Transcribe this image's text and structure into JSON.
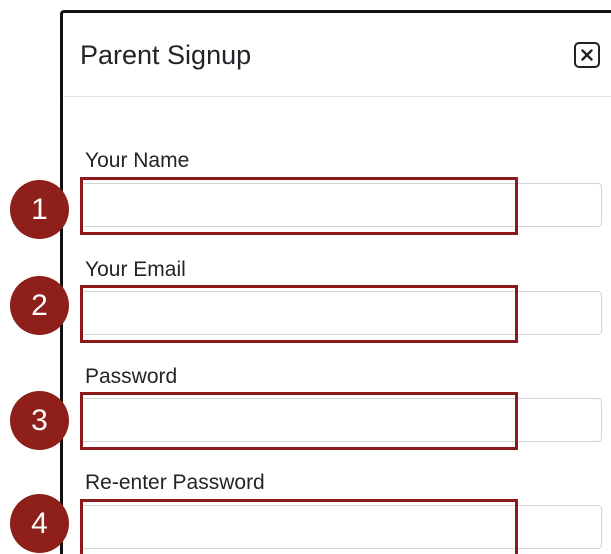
{
  "modal": {
    "title": "Parent Signup",
    "close_label": "Close"
  },
  "fields": [
    {
      "label": "Your Name",
      "value": "",
      "placeholder": ""
    },
    {
      "label": "Your Email",
      "value": "",
      "placeholder": ""
    },
    {
      "label": "Password",
      "value": "",
      "placeholder": ""
    },
    {
      "label": "Re-enter Password",
      "value": "",
      "placeholder": ""
    }
  ],
  "annotations": {
    "steps": [
      "1",
      "2",
      "3",
      "4"
    ],
    "badge_color": "#8e1f1b",
    "highlight_color": "#8b1a1a"
  }
}
